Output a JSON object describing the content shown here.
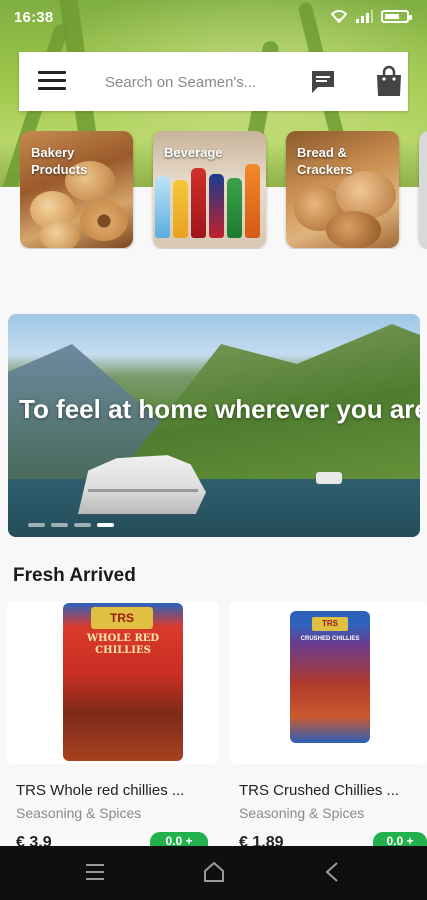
{
  "status_bar": {
    "time": "16:38"
  },
  "header": {
    "search_placeholder": "Search on Seamen's..."
  },
  "categories": [
    {
      "label": "Bakery Products"
    },
    {
      "label": "Beverage"
    },
    {
      "label": "Bread & Crackers"
    }
  ],
  "banner": {
    "text": "To feel at home wherever you are!",
    "slide_count": 4,
    "active_slide": 4
  },
  "fresh_arrived": {
    "title": "Fresh Arrived",
    "products": [
      {
        "name": "TRS Whole red chillies ...",
        "category": "Seasoning & Spices",
        "price": "€ 3.9",
        "pack_brand": "TRS",
        "pack_name": "WHOLE RED CHILLIES",
        "add_label": "0.0 +"
      },
      {
        "name": "TRS Crushed Chillies ...",
        "category": "Seasoning & Spices",
        "price": "€ 1.89",
        "pack_brand": "TRS",
        "pack_name": "CRUSHED CHILLIES",
        "add_label": "0.0 +"
      }
    ]
  },
  "colors": {
    "accent_green": "#22b14c",
    "nav_bar": "#0f0f0f"
  },
  "icons": {
    "menu": "hamburger-icon",
    "messages": "message-icon",
    "cart": "shopping-bag-icon",
    "nav_menu": "recent-apps-icon",
    "nav_home": "home-icon",
    "nav_back": "back-icon"
  }
}
